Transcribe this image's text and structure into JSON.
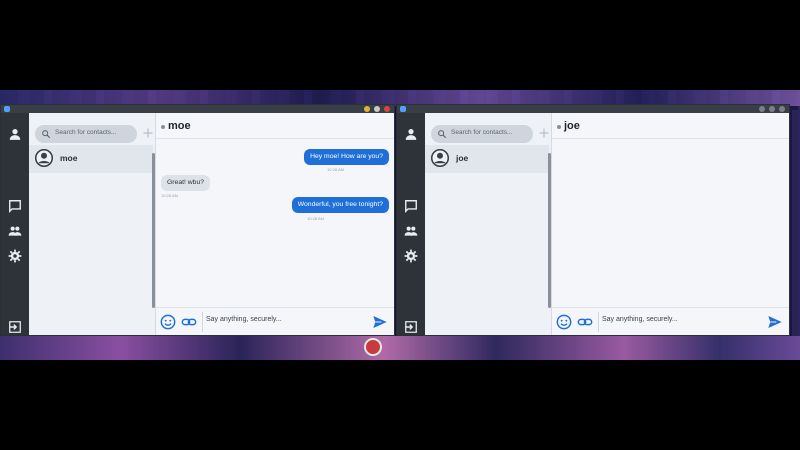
{
  "left_window": {
    "search": {
      "placeholder": "Search for contacts..."
    },
    "contacts": [
      {
        "name": "moe"
      }
    ],
    "chat": {
      "title": "moe",
      "messages": [
        {
          "direction": "out",
          "text": "Hey moe! How are you?",
          "time": "10:28 AM"
        },
        {
          "direction": "in",
          "text": "Great! wbu?",
          "time": "10:28 AM"
        },
        {
          "direction": "out",
          "text": "Wonderful, you free tonight?",
          "time": "10:28 AM"
        }
      ],
      "composer_placeholder": "Say anything, securely..."
    }
  },
  "right_window": {
    "search": {
      "placeholder": "Search for contacts..."
    },
    "contacts": [
      {
        "name": "joe"
      }
    ],
    "chat": {
      "title": "joe",
      "messages": [],
      "composer_placeholder": "Say anything, securely..."
    }
  },
  "icons": {
    "rail": [
      "user-icon",
      "chat-icon",
      "group-icon",
      "settings-icon",
      "logout-icon"
    ],
    "composer": [
      "emoji-icon",
      "link-icon",
      "send-icon"
    ]
  },
  "colors": {
    "accent": "#1f6fd8",
    "rail_bg": "#2e3239",
    "incoming_bubble": "#dde2e8"
  }
}
